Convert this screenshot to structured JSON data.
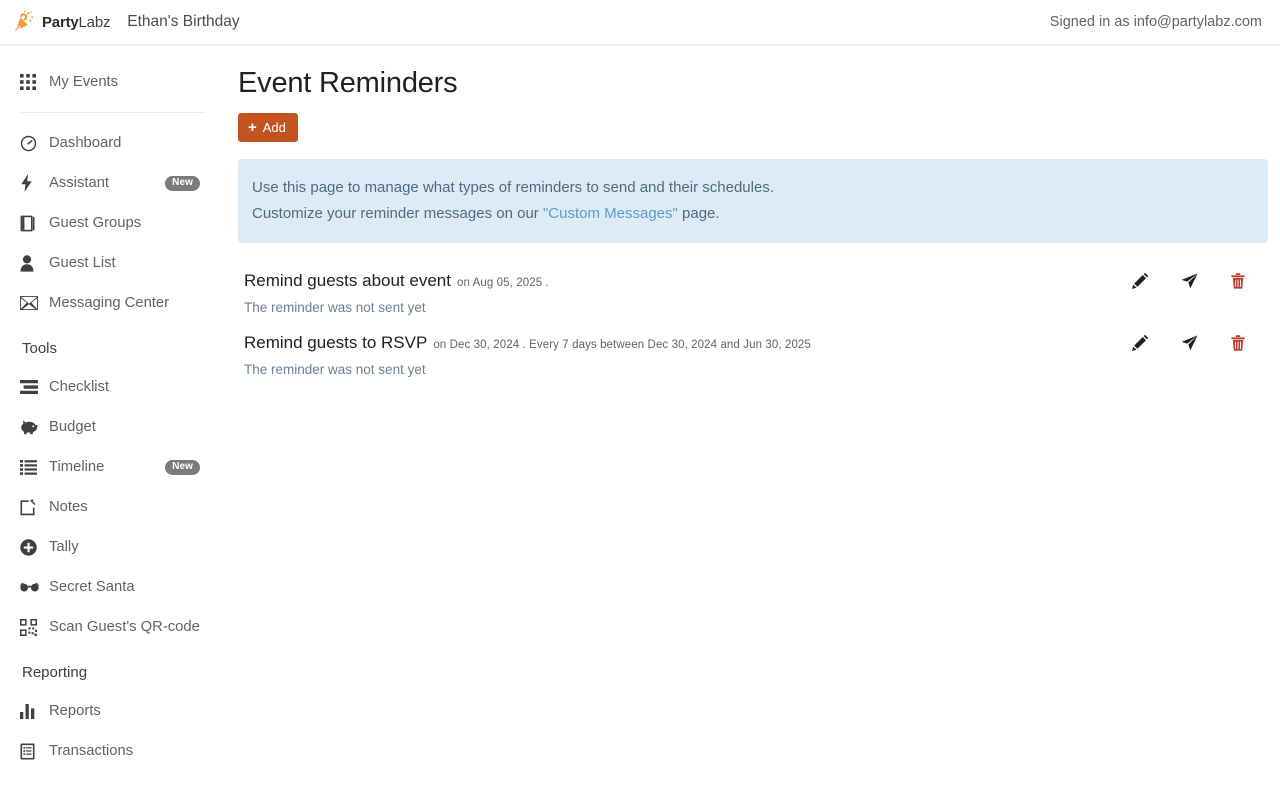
{
  "header": {
    "brand_name_bold": "Party",
    "brand_name_light": "Labz",
    "logo_icon": "party-popper-logo",
    "event_title": "Ethan's Birthday",
    "signed_in": "Signed in as info@partylabz.com"
  },
  "sidebar": {
    "top_items": [
      {
        "label": "My Events",
        "icon": "grid-icon"
      }
    ],
    "main_items": [
      {
        "label": "Dashboard",
        "icon": "dashboard-gauge-icon",
        "badge": null
      },
      {
        "label": "Assistant",
        "icon": "lightning-bolt-icon",
        "badge": "New"
      },
      {
        "label": "Guest Groups",
        "icon": "book-groups-icon",
        "badge": null
      },
      {
        "label": "Guest List",
        "icon": "person-icon",
        "badge": null
      },
      {
        "label": "Messaging Center",
        "icon": "envelope-icon",
        "badge": null
      }
    ],
    "sections": [
      {
        "title": "Tools",
        "items": [
          {
            "label": "Checklist",
            "icon": "checklist-icon",
            "badge": null
          },
          {
            "label": "Budget",
            "icon": "piggy-bank-icon",
            "badge": null
          },
          {
            "label": "Timeline",
            "icon": "list-timeline-icon",
            "badge": "New"
          },
          {
            "label": "Notes",
            "icon": "note-edit-icon",
            "badge": null
          },
          {
            "label": "Tally",
            "icon": "plus-circle-icon",
            "badge": null
          },
          {
            "label": "Secret Santa",
            "icon": "glasses-icon",
            "badge": null
          },
          {
            "label": "Scan Guest's QR-code",
            "icon": "qr-code-icon",
            "badge": null
          }
        ]
      },
      {
        "title": "Reporting",
        "items": [
          {
            "label": "Reports",
            "icon": "bar-chart-icon",
            "badge": null
          },
          {
            "label": "Transactions",
            "icon": "document-list-icon",
            "badge": null
          }
        ]
      }
    ]
  },
  "main": {
    "page_title": "Event Reminders",
    "add_button": {
      "label": "Add",
      "icon": "plus-icon"
    },
    "info_banner": {
      "line1": "Use this page to manage what types of reminders to send and their schedules.",
      "line2_before": "Customize your reminder messages on our ",
      "line2_link": "\"Custom Messages\"",
      "line2_after": " page."
    },
    "reminders": [
      {
        "name": "Remind guests about event",
        "meta": "on Aug 05, 2025 .",
        "status": "The reminder was not sent yet",
        "actions": [
          {
            "name": "edit-reminder-button",
            "icon": "pencil-icon"
          },
          {
            "name": "send-reminder-button",
            "icon": "paper-plane-icon"
          },
          {
            "name": "delete-reminder-button",
            "icon": "trash-icon"
          }
        ]
      },
      {
        "name": "Remind guests to RSVP",
        "meta": "on Dec 30, 2024 . Every 7 days between Dec 30, 2024 and Jun 30, 2025",
        "status": "The reminder was not sent yet",
        "actions": [
          {
            "name": "edit-reminder-button",
            "icon": "pencil-icon"
          },
          {
            "name": "send-reminder-button",
            "icon": "paper-plane-icon"
          },
          {
            "name": "delete-reminder-button",
            "icon": "trash-icon"
          }
        ]
      }
    ]
  },
  "colors": {
    "accent_orange": "#c2541f",
    "banner_bg": "#dcebf5",
    "banner_text": "#4c6b82",
    "banner_link": "#5b9ec4",
    "badge_gray": "#7b7b7b",
    "danger_red": "#c0392b"
  }
}
